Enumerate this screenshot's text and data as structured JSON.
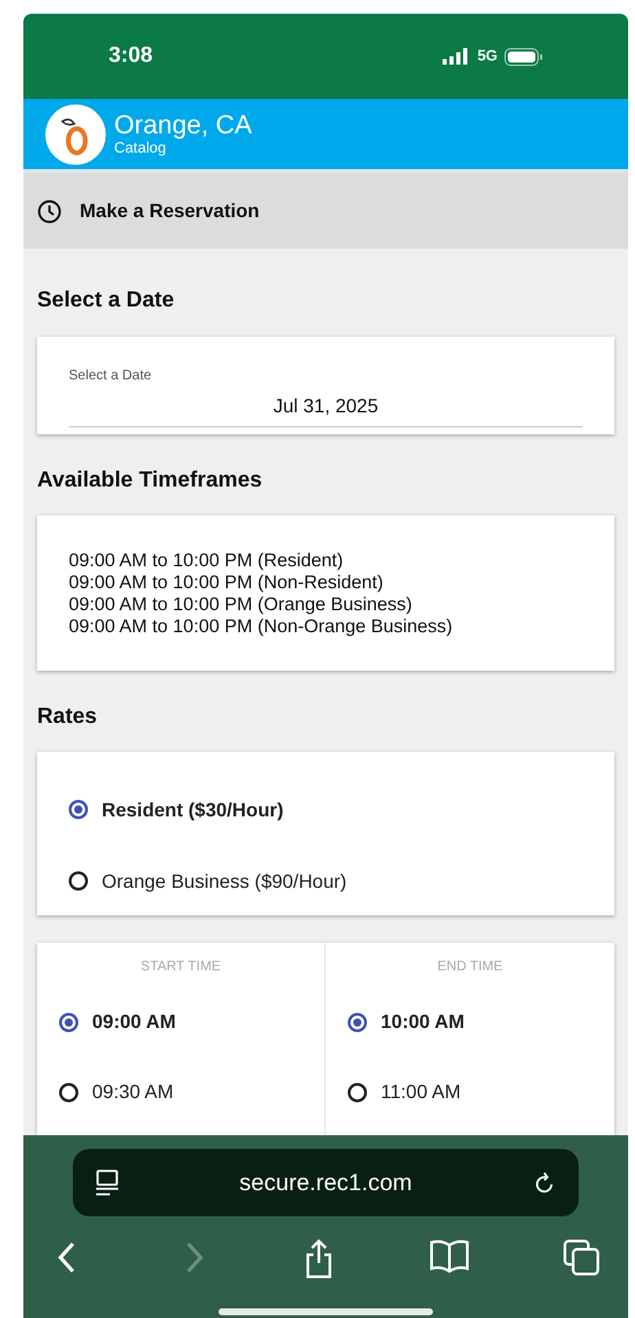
{
  "status_bar": {
    "time": "3:08",
    "network": "5G"
  },
  "header": {
    "title": "Orange, CA",
    "subtitle": "Catalog"
  },
  "section_bar": {
    "title": "Make a Reservation"
  },
  "date_section": {
    "heading": "Select a Date",
    "field_label": "Select a Date",
    "value": "Jul 31, 2025"
  },
  "timeframes": {
    "heading": "Available Timeframes",
    "items": [
      "09:00 AM to 10:00 PM (Resident)",
      "09:00 AM to 10:00 PM (Non-Resident)",
      "09:00 AM to 10:00 PM (Orange Business)",
      "09:00 AM to 10:00 PM (Non-Orange Business)"
    ]
  },
  "rates": {
    "heading": "Rates",
    "options": [
      {
        "label": "Resident ($30/Hour)",
        "selected": true
      },
      {
        "label": "Orange Business ($90/Hour)",
        "selected": false
      }
    ]
  },
  "times": [
    {
      "heading": "START TIME",
      "options": [
        {
          "label": "09:00 AM",
          "selected": true
        },
        {
          "label": "09:30 AM",
          "selected": false
        }
      ]
    },
    {
      "heading": "END TIME",
      "options": [
        {
          "label": "10:00 AM",
          "selected": true
        },
        {
          "label": "11:00 AM",
          "selected": false
        }
      ]
    }
  ],
  "browser": {
    "url": "secure.rec1.com"
  }
}
